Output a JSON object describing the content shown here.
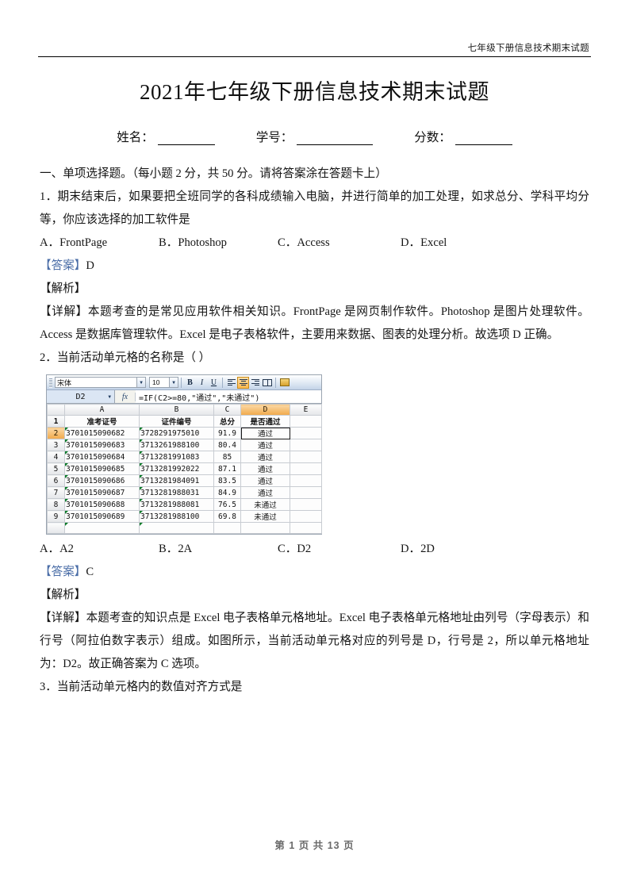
{
  "header": {
    "running_title": "七年级下册信息技术期末试题"
  },
  "title": "2021年七年级下册信息技术期末试题",
  "idline": {
    "name_label": "姓名：",
    "student_id_label": "学号：",
    "score_label": "分数："
  },
  "section": {
    "heading": "一、单项选择题。（每小题 2 分，共 50 分。请将答案涂在答题卡上）"
  },
  "questions": [
    {
      "stem": "1．期末结束后，如果要把全班同学的各科成绩输入电脑，并进行简单的加工处理，如求总分、学科平均分等，你应该选择的加工软件是",
      "options": [
        "A．FrontPage",
        "B．Photoshop",
        "C．Access",
        "D．Excel"
      ],
      "answer_label": "【答案】",
      "answer_value": "D",
      "analysis_label": "【解析】",
      "detail": "【详解】本题考查的是常见应用软件相关知识。FrontPage 是网页制作软件。Photoshop 是图片处理软件。Access 是数据库管理软件。Excel 是电子表格软件，主要用来数据、图表的处理分析。故选项 D 正确。"
    },
    {
      "stem": "2．当前活动单元格的名称是（    ）",
      "options": [
        "A．A2",
        "B．2A",
        "C．D2",
        "D．2D"
      ],
      "answer_label": "【答案】",
      "answer_value": "C",
      "analysis_label": "【解析】",
      "detail": "【详解】本题考查的知识点是 Excel 电子表格单元格地址。Excel 电子表格单元格地址由列号（字母表示）和行号（阿拉伯数字表示）组成。如图所示，当前活动单元格对应的列号是 D，行号是 2，所以单元格地址为：D2。故正确答案为 C 选项。"
    },
    {
      "stem": "3．当前活动单元格内的数值对齐方式是"
    }
  ],
  "excel_figure": {
    "toolbar": {
      "font_name": "宋体",
      "font_size": "10",
      "bold": "B",
      "italic": "I",
      "underline": "U",
      "align_left_name": "align-left",
      "align_center_name": "align-center",
      "align_right_name": "align-right",
      "merge_center_name": "merge-and-center",
      "currency_name": "currency-style",
      "active_align": "align-center"
    },
    "name_box": "D2",
    "fx_label": "fx",
    "formula": "=IF(C2>=80,\"通过\",\"未通过\")",
    "column_headers": [
      "A",
      "B",
      "C",
      "D",
      "E"
    ],
    "selected_column": "D",
    "selected_row": "2",
    "active_cell": "D2",
    "row_numbers": [
      "1",
      "2",
      "3",
      "4",
      "5",
      "6",
      "7",
      "8",
      "9"
    ],
    "table_headers": [
      "准考证号",
      "证件编号",
      "总分",
      "是否通过"
    ],
    "rows": [
      {
        "row": "2",
        "a": "3701015090682",
        "b": "3728291975010",
        "c": "91.9",
        "d": "通过",
        "failed": false
      },
      {
        "row": "3",
        "a": "3701015090683",
        "b": "3713261988100",
        "c": "80.4",
        "d": "通过",
        "failed": false
      },
      {
        "row": "4",
        "a": "3701015090684",
        "b": "3713281991083",
        "c": "85",
        "d": "通过",
        "failed": false
      },
      {
        "row": "5",
        "a": "3701015090685",
        "b": "3713281992022",
        "c": "87.1",
        "d": "通过",
        "failed": false
      },
      {
        "row": "6",
        "a": "3701015090686",
        "b": "3713281984091",
        "c": "83.5",
        "d": "通过",
        "failed": false
      },
      {
        "row": "7",
        "a": "3701015090687",
        "b": "3713281988031",
        "c": "84.9",
        "d": "通过",
        "failed": false
      },
      {
        "row": "8",
        "a": "3701015090688",
        "b": "3713281988081",
        "c": "76.5",
        "d": "未通过",
        "failed": true
      },
      {
        "row": "9",
        "a": "3701015090689",
        "b": "3713281988100",
        "c": "69.8",
        "d": "未通过",
        "failed": true
      }
    ]
  },
  "footer": "第 1 页 共 13 页",
  "colors": {
    "answer_label": "#4a6da7",
    "fail_text": "#d40000",
    "excel_selection": "#f0a94a",
    "footer_text": "#6b6b6b"
  }
}
